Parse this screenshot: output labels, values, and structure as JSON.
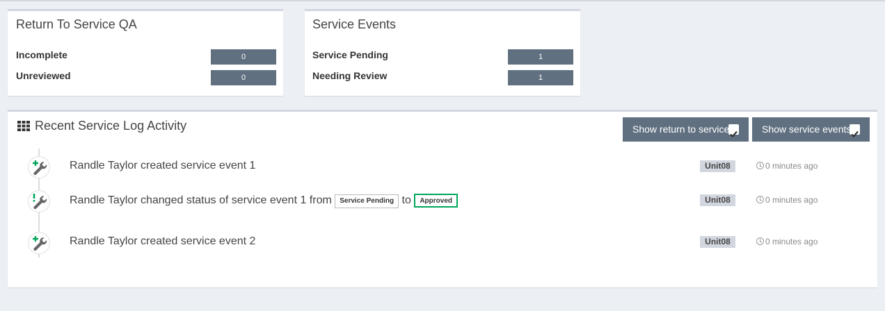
{
  "rts_qa": {
    "title": "Return To Service QA",
    "rows": [
      {
        "label": "Incomplete",
        "value": "0"
      },
      {
        "label": "Unreviewed",
        "value": "0"
      }
    ]
  },
  "service_events": {
    "title": "Service Events",
    "rows": [
      {
        "label": "Service Pending",
        "value": "1"
      },
      {
        "label": "Needing Review",
        "value": "1"
      }
    ]
  },
  "activity": {
    "title": "Recent Service Log Activity",
    "show_rts_label": "Show return to service",
    "show_events_label": "Show service events",
    "items": [
      {
        "icon": "wrench-plus-icon",
        "text": "Randle Taylor created service event 1",
        "unit": "Unit08",
        "time": "0 minutes ago"
      },
      {
        "icon": "wrench-exclamation-icon",
        "text": "Randle Taylor changed status of service event 1 from",
        "from_status": "Service Pending",
        "to_word": "to",
        "to_status": "Approved",
        "unit": "Unit08",
        "time": "0 minutes ago"
      },
      {
        "icon": "wrench-plus-icon",
        "text": "Randle Taylor created service event 2",
        "unit": "Unit08",
        "time": "0 minutes ago"
      }
    ]
  },
  "colors": {
    "accent_bar": "#607080",
    "approved": "#00a65a",
    "plus": "#00a65a",
    "exclamation": "#00a65a",
    "background": "#ecf0f5"
  }
}
